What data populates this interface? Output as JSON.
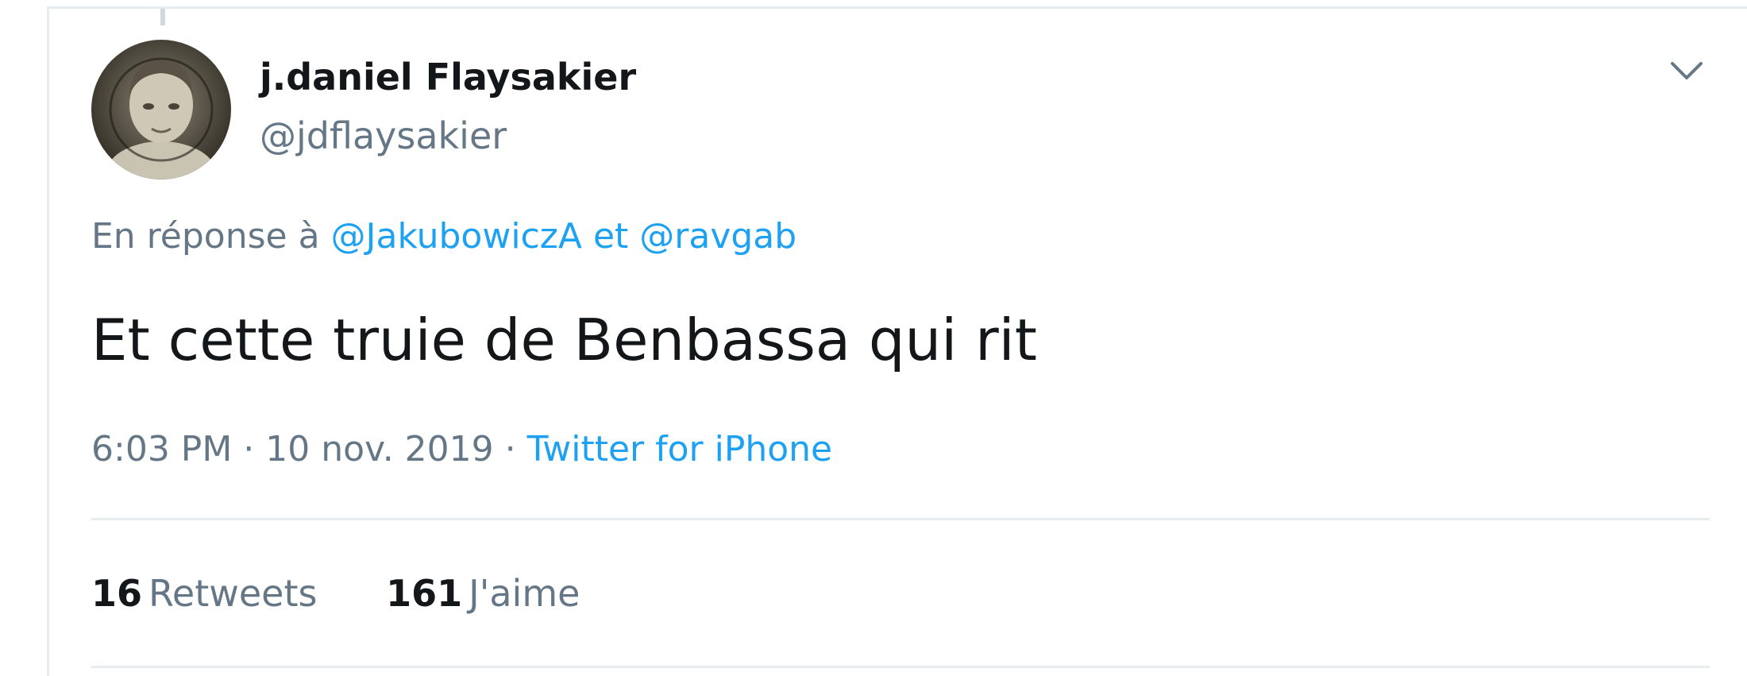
{
  "tweet": {
    "author": {
      "display_name": "j.daniel Flaysakier",
      "handle": "@jdflaysakier",
      "avatar_icon": "profile-photo"
    },
    "reply_to": {
      "prefix": "En réponse à",
      "mention_1": "@JakubowiczA",
      "conjunction": "et",
      "mention_2": "@ravgab"
    },
    "text": "Et cette truie de Benbassa qui rit",
    "meta": {
      "time": "6:03 PM",
      "separator_1": "·",
      "date": "10 nov. 2019",
      "separator_2": "·",
      "source": "Twitter for iPhone"
    },
    "stats": {
      "retweets_count": "16",
      "retweets_label": "Retweets",
      "likes_count": "161",
      "likes_label": "J'aime"
    },
    "menu_icon": "chevron-down-icon"
  },
  "colors": {
    "link": "#1da1f2",
    "muted": "#657786",
    "text": "#14171a",
    "border": "#e6ecf0"
  }
}
